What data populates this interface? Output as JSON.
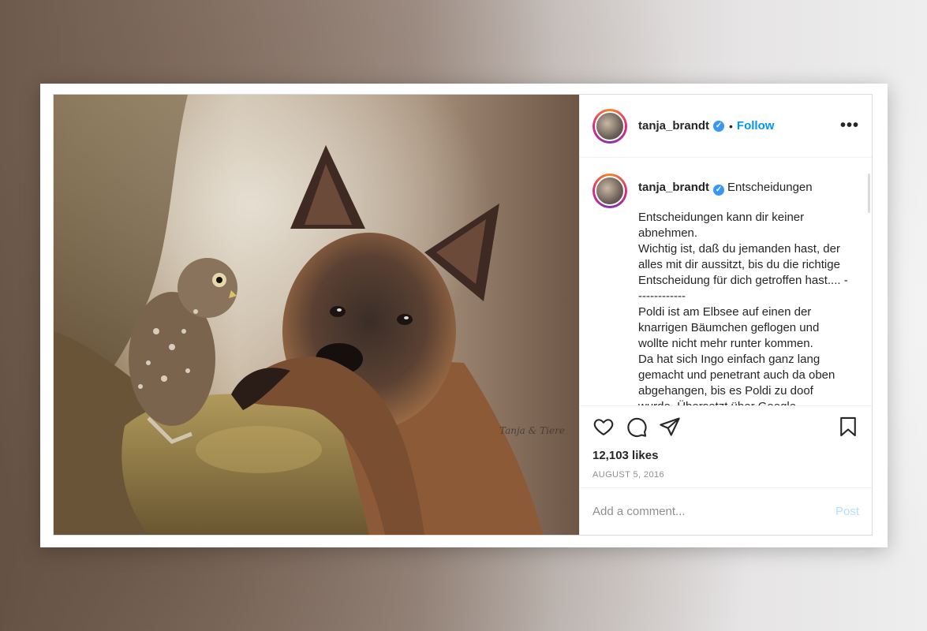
{
  "post": {
    "username": "tanja_brandt",
    "verified_glyph": "✓",
    "dot": "•",
    "follow_label": "Follow",
    "more_label": "•••",
    "caption_title": "Entscheidungen",
    "caption_body": "Entscheidungen kann dir keiner abnehmen.\nWichtig ist, daß du jemanden hast, der alles mit dir aussitzt, bis du die richtige Entscheidung für dich getroffen hast.... -------------\nPoldi ist am Elbsee auf einen der knarrigen Bäumchen geflogen und wollte nicht mehr runter kommen.\nDa hat sich Ingo einfach ganz lang gemacht und penetrant auch da oben abgehangen, bis es Poldi zu doof wurde. Übersetzt über Google Übersetzer",
    "likes": "12,103 likes",
    "date": "AUGUST 5, 2016",
    "comment_placeholder": "Add a comment...",
    "post_label": "Post"
  },
  "icons": {
    "like": "heart-icon",
    "comment": "comment-icon",
    "share": "paper-plane-icon",
    "save": "bookmark-icon",
    "more": "more-options-icon"
  },
  "colors": {
    "accent": "#0095f6",
    "verified": "#3897f0",
    "post_disabled": "#b2dffc"
  }
}
